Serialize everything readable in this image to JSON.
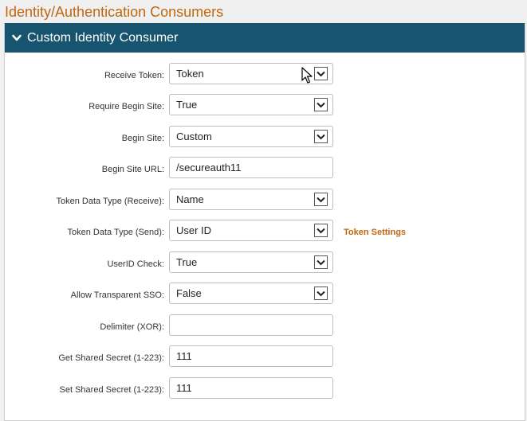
{
  "page": {
    "title": "Identity/Authentication Consumers"
  },
  "panel": {
    "title": "Custom Identity Consumer"
  },
  "fields": [
    {
      "label": "Receive Token:",
      "type": "select",
      "value": "Token"
    },
    {
      "label": "Require Begin Site:",
      "type": "select",
      "value": "True"
    },
    {
      "label": "Begin Site:",
      "type": "select",
      "value": "Custom"
    },
    {
      "label": "Begin Site URL:",
      "type": "input",
      "value": "/secureauth11"
    },
    {
      "label": "Token Data Type (Receive):",
      "type": "select",
      "value": "Name"
    },
    {
      "label": "Token Data Type (Send):",
      "type": "select",
      "value": "User ID"
    },
    {
      "label": "UserID Check:",
      "type": "select",
      "value": "True"
    },
    {
      "label": "Allow Transparent SSO:",
      "type": "select",
      "value": "False"
    },
    {
      "label": "Delimiter (XOR):",
      "type": "input",
      "value": ""
    },
    {
      "label": "Get Shared Secret (1-223):",
      "type": "input",
      "value": "111"
    },
    {
      "label": "Set Shared Secret (1-223):",
      "type": "input",
      "value": "111"
    }
  ],
  "token_settings_link": "Token Settings",
  "icons": {
    "collapse": "chevron-down-icon",
    "dropdown": "dropdown-arrow-icon",
    "cursor": "mouse-pointer-icon"
  },
  "colors": {
    "title": "#c0670f",
    "header_bg": "#17546f",
    "link": "#c0670f"
  }
}
